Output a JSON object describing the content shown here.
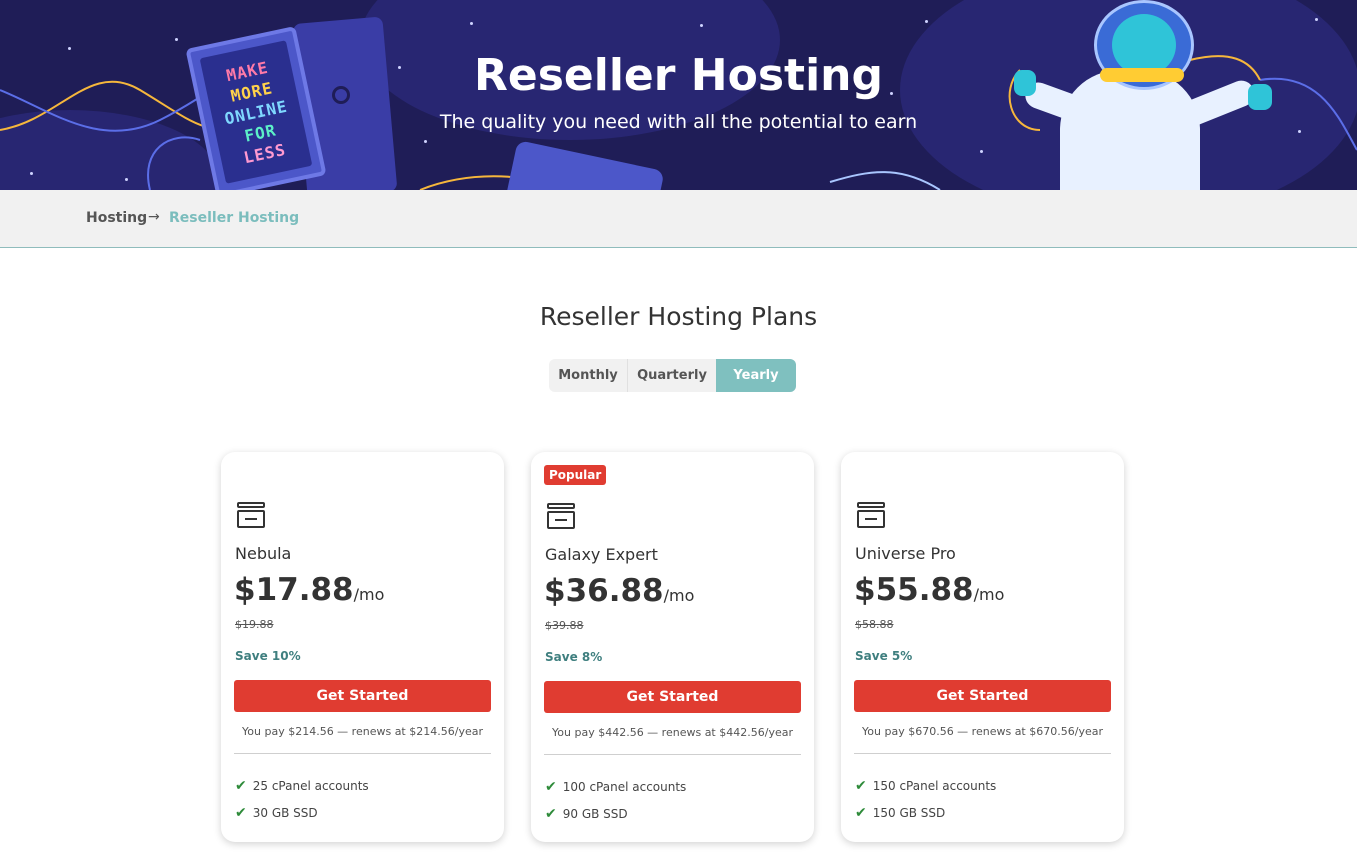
{
  "hero": {
    "title": "Reseller Hosting",
    "subtitle": "The quality you need with all the potential to earn",
    "sign_lines": [
      "MAKE",
      "MORE",
      "ONLINE",
      "FOR",
      "LESS"
    ]
  },
  "breadcrumb": {
    "home": "Hosting",
    "arrow": "→",
    "current": "Reseller Hosting"
  },
  "plans": {
    "title": "Reseller Hosting Plans",
    "billing_options": [
      "Monthly",
      "Quarterly",
      "Yearly"
    ],
    "selected_billing": "Yearly",
    "items": [
      {
        "badge": "",
        "name": "Nebula",
        "price": "$17.88",
        "per": "/mo",
        "old_price": "$19.88",
        "save": "Save 10%",
        "cta": "Get Started",
        "you_pay": "You pay $214.56 — renews at $214.56/year",
        "features": [
          "25 cPanel accounts",
          "30 GB SSD"
        ]
      },
      {
        "badge": "Popular",
        "name": "Galaxy Expert",
        "price": "$36.88",
        "per": "/mo",
        "old_price": "$39.88",
        "save": "Save 8%",
        "cta": "Get Started",
        "you_pay": "You pay $442.56 — renews at $442.56/year",
        "features": [
          "100 cPanel accounts",
          "90 GB SSD"
        ]
      },
      {
        "badge": "",
        "name": "Universe Pro",
        "price": "$55.88",
        "per": "/mo",
        "old_price": "$58.88",
        "save": "Save 5%",
        "cta": "Get Started",
        "you_pay": "You pay $670.56 — renews at $670.56/year",
        "features": [
          "150 cPanel accounts",
          "150 GB SSD"
        ]
      }
    ]
  },
  "colors": {
    "hero_bg": "#1f1d57",
    "accent_teal": "#7fc0bf",
    "cta_red": "#e03c31",
    "check_green": "#2e8b3a"
  },
  "icons": {
    "plan": "server-icon",
    "feature": "check-icon",
    "breadcrumb_sep": "arrow-right-icon"
  }
}
